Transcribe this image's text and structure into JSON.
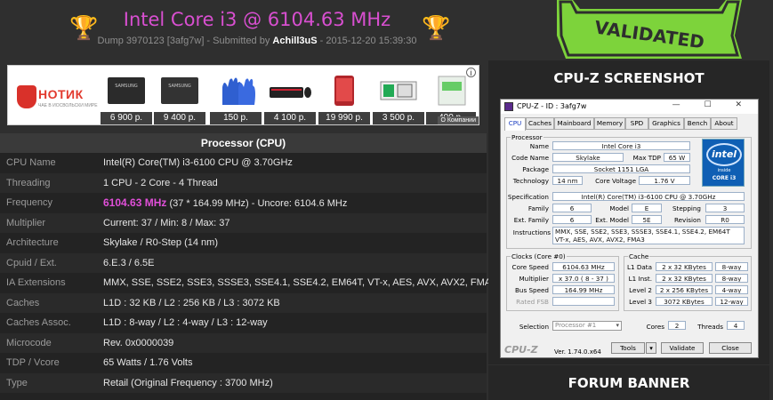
{
  "header": {
    "title": "Intel Core i3 @ 6104.63 MHz",
    "dump": "Dump 3970123 [3afg7w] - Submitted by",
    "user": "Achill3uS",
    "date": "- 2015-12-20 15:39:30",
    "stamp": "VALIDATED"
  },
  "ad": {
    "brand": "НОТИК",
    "tagline": "ЧАЕ В ИОСВОЛЬСКИ МИРЕ",
    "info": "i",
    "company": "О Компании",
    "prices": [
      "6 900 р.",
      "9 400 р.",
      "150 р.",
      "4 100 р.",
      "19 990 р.",
      "3 500 р.",
      "400 р."
    ]
  },
  "processor": {
    "heading": "Processor (CPU)",
    "rows": [
      {
        "key": "CPU Name",
        "value": "Intel(R) Core(TM) i3-6100 CPU @ 3.70GHz"
      },
      {
        "key": "Threading",
        "value": "1 CPU - 2 Core - 4 Thread"
      },
      {
        "key": "Frequency",
        "freq": "6104.63 MHz",
        "value": "(37 * 164.99 MHz) - Uncore: 6104.6 MHz"
      },
      {
        "key": "Multiplier",
        "value": "Current: 37 / Min: 8 / Max: 37"
      },
      {
        "key": "Architecture",
        "value": "Skylake / R0-Step (14 nm)"
      },
      {
        "key": "Cpuid / Ext.",
        "value": "6.E.3 / 6.5E"
      },
      {
        "key": "IA Extensions",
        "value": "MMX, SSE, SSE2, SSE3, SSSE3, SSE4.1, SSE4.2, EM64T, VT-x, AES, AVX, AVX2, FMA3"
      },
      {
        "key": "Caches",
        "value": "L1D : 32 KB / L2 : 256 KB / L3 : 3072 KB"
      },
      {
        "key": "Caches Assoc.",
        "value": "L1D : 8-way / L2 : 4-way / L3 : 12-way"
      },
      {
        "key": "Microcode",
        "value": "Rev. 0x0000039"
      },
      {
        "key": "TDP / Vcore",
        "value": "65 Watts / 1.76 Volts"
      },
      {
        "key": "Type",
        "value": "Retail (Original Frequency : 3700 MHz)"
      }
    ]
  },
  "right": {
    "screenshot_heading": "CPU-Z SCREENSHOT",
    "forum_heading": "FORUM BANNER"
  },
  "cpuz": {
    "title": "CPU-Z  - ID : 3afg7w",
    "window_buttons": "—  ☐  ✕",
    "tabs": [
      "CPU",
      "Caches",
      "Mainboard",
      "Memory",
      "SPD",
      "Graphics",
      "Bench",
      "About"
    ],
    "processor_group": "Processor",
    "name_label": "Name",
    "name": "Intel Core i3",
    "codename_label": "Code Name",
    "codename": "Skylake",
    "maxtdp_label": "Max TDP",
    "maxtdp": "65 W",
    "package_label": "Package",
    "package": "Socket 1151 LGA",
    "tech_label": "Technology",
    "tech": "14 nm",
    "corevolt_label": "Core Voltage",
    "corevolt": "1.76 V",
    "spec_label": "Specification",
    "spec": "Intel(R) Core(TM) i3-6100 CPU @ 3.70GHz",
    "family_label": "Family",
    "family": "6",
    "model_label": "Model",
    "model": "E",
    "stepping_label": "Stepping",
    "stepping": "3",
    "extfamily_label": "Ext. Family",
    "extfamily": "6",
    "extmodel_label": "Ext. Model",
    "extmodel": "5E",
    "revision_label": "Revision",
    "revision": "R0",
    "instr_label": "Instructions",
    "instr1": "MMX, SSE, SSE2, SSE3, SSSE3, SSE4.1, SSE4.2, EM64T",
    "instr2": "VT-x, AES, AVX, AVX2, FMA3",
    "clocks_group": "Clocks (Core #0)",
    "corespeed_label": "Core Speed",
    "corespeed": "6104.63 MHz",
    "mult_label": "Multiplier",
    "mult": "x 37.0 ( 8 - 37 )",
    "bus_label": "Bus Speed",
    "bus": "164.99 MHz",
    "fsb_label": "Rated FSB",
    "fsb": "",
    "cache_group": "Cache",
    "l1d_label": "L1 Data",
    "l1d": "2 x 32 KBytes",
    "l1d_way": "8-way",
    "l1i_label": "L1 Inst.",
    "l1i": "2 x 32 KBytes",
    "l1i_way": "8-way",
    "l2_label": "Level 2",
    "l2": "2 x 256 KBytes",
    "l2_way": "4-way",
    "l3_label": "Level 3",
    "l3": "3072 KBytes",
    "l3_way": "12-way",
    "selection_label": "Selection",
    "selection": "Processor #1",
    "cores_label": "Cores",
    "cores": "2",
    "threads_label": "Threads",
    "threads": "4",
    "logo": "CPU-Z",
    "version": "Ver. 1.74.0.x64",
    "tools": "Tools",
    "validate": "Validate",
    "close": "Close",
    "intel_logo": "intel",
    "intel_inside": "inside",
    "intel_core": "CORE i3"
  }
}
